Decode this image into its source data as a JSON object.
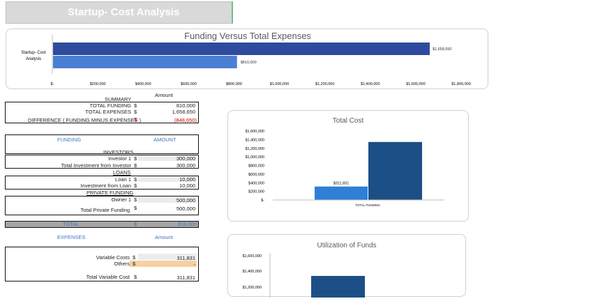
{
  "title": "Startup- Cost Analysis",
  "chart_data": [
    {
      "type": "bar",
      "orientation": "horizontal",
      "title": "Funding Versus Total Expenses",
      "categories": [
        "Startup- Cost Analysis"
      ],
      "category_label": "Startup- Cost\nAnalysis",
      "series": [
        {
          "values": [
            1658650
          ],
          "color": "#2e4b9e",
          "label": "$1,658,650"
        },
        {
          "values": [
            810000
          ],
          "color": "#4a7fd4",
          "label": "$810,000"
        }
      ],
      "xlim": [
        0,
        1800000
      ],
      "ticks": [
        "$-",
        "$200,000",
        "$400,000",
        "$600,000",
        "$800,000",
        "$1,000,000",
        "$1,200,000",
        "$1,400,000",
        "$1,600,000",
        "$1,800,000"
      ]
    },
    {
      "type": "bar",
      "title": "Total Cost",
      "categories": [
        "TOTAL FUNDING"
      ],
      "series": [
        {
          "values": [
            311831
          ],
          "color": "#2f7ed8",
          "label": "$311,831"
        },
        {
          "values": [
            1345000
          ],
          "color": "#1c4f86",
          "label": ""
        }
      ],
      "ylim": [
        0,
        1600000
      ],
      "ticks": [
        "$-",
        "$200,000",
        "$400,000",
        "$600,000",
        "$800,000",
        "$1,000,000",
        "$1,200,000",
        "$1,400,000",
        "$1,600,000"
      ]
    },
    {
      "type": "bar",
      "title": "Utilization of Funds",
      "series": [
        {
          "values": [
            1345000
          ],
          "color": "#1c4f86"
        }
      ],
      "ticks_visible": [
        "$1,600,000",
        "$1,400,000",
        "$1,200,000"
      ]
    }
  ],
  "summary": {
    "amount_header": "Amount",
    "heading": "SUMMARY",
    "rows": [
      {
        "label": "TOTAL FUNDING",
        "cur": "$",
        "value": "810,000"
      },
      {
        "label": "TOTAL EXPENSES",
        "cur": "$",
        "value": "1,658,650"
      }
    ],
    "diff_label": "DIFFERENCE  ( FUNDING MINUS EXPENSES )",
    "diff_cur": "$",
    "diff_value": "(848,650)"
  },
  "funding": {
    "header": "FUNDING",
    "amount_header": "AMOUNT",
    "investors_heading": "INVESTORS",
    "investor1_label": "Investor 1",
    "investor1_value": "300,000",
    "investor_total_label": "Total Investment from Investor",
    "investor_total_value": "300,000",
    "loans_heading": "LOANS",
    "loan1_label": "Loan 1",
    "loan1_value": "10,000",
    "loan_total_label": "Investment from Loan",
    "loan_total_value": "10,000",
    "private_heading": "PRIVATE FUNDING",
    "owner1_label": "Owner 1",
    "owner1_value": "500,000",
    "private_total_label": "Total Private Funding",
    "private_total_value": "500,000",
    "total_label": "TOTAL",
    "total_value": "810,000",
    "cur": "$"
  },
  "expenses": {
    "header": "EXPENSES",
    "amount_header": "Amount",
    "variable_label": "Variable Costs",
    "variable_value": "311,831",
    "others_label": "Others",
    "others_value": "-",
    "total_variable_label": "Total Variable Cost",
    "total_variable_value": "311,831",
    "cur": "$"
  }
}
